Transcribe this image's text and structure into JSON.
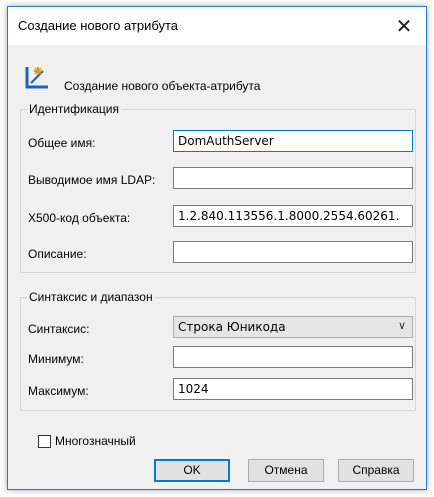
{
  "window": {
    "title": "Создание нового атрибута",
    "close_glyph": "✕"
  },
  "header": {
    "text": "Создание нового объекта-атрибута",
    "icon": "new-attribute-icon"
  },
  "identification": {
    "title": "Идентификация",
    "common_name_label": "Общее имя:",
    "common_name_value": "DomAuthServer",
    "ldap_label": "Выводимое имя LDAP:",
    "ldap_value": "",
    "oid_label": "X500-код объекта:",
    "oid_value": "1.2.840.113556.1.8000.2554.60261.",
    "desc_label": "Описание:",
    "desc_value": ""
  },
  "syntax": {
    "title": "Синтаксис и диапазон",
    "syntax_label": "Синтаксис:",
    "syntax_value": "Строка Юникода",
    "min_label": "Минимум:",
    "min_value": "",
    "max_label": "Максимум:",
    "max_value": "1024"
  },
  "multivalued": {
    "label": "Многозначный",
    "checked": false
  },
  "buttons": {
    "ok": "OK",
    "cancel": "Отмена",
    "help": "Справка"
  },
  "colors": {
    "accent": "#0078d7",
    "icon_blue": "#1f5fbf",
    "icon_gold": "#d9a21a"
  }
}
